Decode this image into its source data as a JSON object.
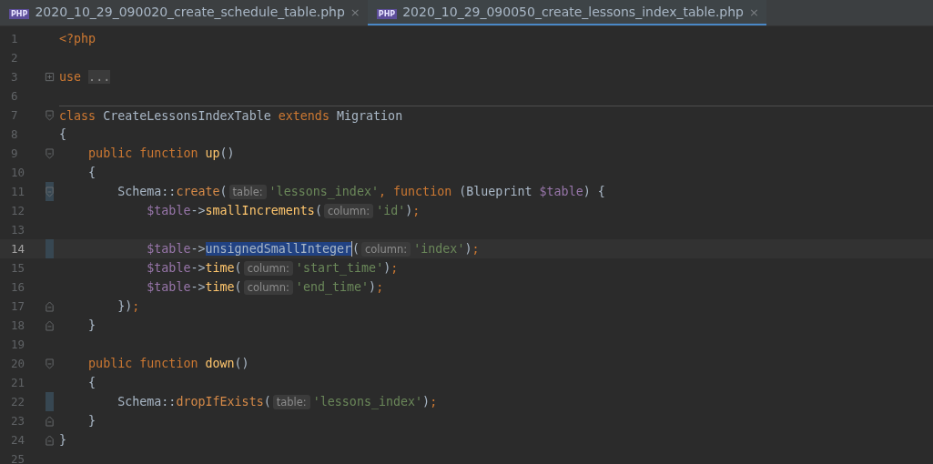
{
  "tabs": [
    {
      "icon_text": "PHP",
      "label": "2020_10_29_090020_create_schedule_table.php",
      "close": "×",
      "selected": false
    },
    {
      "icon_text": "PHP",
      "label": "2020_10_29_090050_create_lessons_index_table.php",
      "close": "×",
      "selected": true
    }
  ],
  "editor": {
    "lines": [
      {
        "number": "1",
        "changed": false,
        "current": false,
        "separator": false,
        "tokens": [
          {
            "kind": "keyword",
            "text": "<?php"
          }
        ]
      },
      {
        "number": "2",
        "changed": false,
        "current": false,
        "separator": false
      },
      {
        "number": "3",
        "fold": {
          "kind": "collapsed"
        },
        "changed": false,
        "current": false,
        "separator": false,
        "tokens": [
          {
            "kind": "keyword",
            "text": "use "
          },
          {
            "kind": "folded",
            "text": "..."
          }
        ]
      },
      {
        "number": "6",
        "changed": false,
        "current": false,
        "separator": false
      },
      {
        "number": "7",
        "fold": {
          "kind": "start"
        },
        "changed": false,
        "current": false,
        "separator": true,
        "tokens": [
          {
            "kind": "keyword",
            "text": "class "
          },
          {
            "kind": "plain",
            "text": "CreateLessonsIndexTable "
          },
          {
            "kind": "keyword",
            "text": "extends "
          },
          {
            "kind": "plain",
            "text": "Migration"
          }
        ]
      },
      {
        "number": "8",
        "changed": false,
        "current": false,
        "separator": false,
        "tokens": [
          {
            "kind": "plain",
            "text": "{"
          }
        ]
      },
      {
        "number": "9",
        "fold": {
          "kind": "start"
        },
        "changed": false,
        "current": false,
        "separator": false,
        "tokens": [
          {
            "kind": "keyword",
            "text": "    public function "
          },
          {
            "kind": "function",
            "text": "up"
          },
          {
            "kind": "plain",
            "text": "()"
          }
        ]
      },
      {
        "number": "10",
        "changed": false,
        "current": false,
        "separator": false,
        "tokens": [
          {
            "kind": "plain",
            "text": "    {"
          }
        ]
      },
      {
        "number": "11",
        "fold": {
          "kind": "start"
        },
        "changed": true,
        "current": false,
        "separator": false,
        "tokens": [
          {
            "kind": "plain",
            "text": "        Schema::"
          },
          {
            "kind": "method",
            "text": "create"
          },
          {
            "kind": "plain",
            "text": "("
          },
          {
            "kind": "hint",
            "text": "table:"
          },
          {
            "kind": "string",
            "text": "'lessons_index'"
          },
          {
            "kind": "keyword",
            "text": ", function "
          },
          {
            "kind": "plain",
            "text": "(Blueprint "
          },
          {
            "kind": "variable",
            "text": "$table"
          },
          {
            "kind": "plain",
            "text": ") {"
          }
        ]
      },
      {
        "number": "12",
        "changed": false,
        "current": false,
        "separator": false,
        "tokens": [
          {
            "kind": "variable",
            "text": "            $table"
          },
          {
            "kind": "plain",
            "text": "->"
          },
          {
            "kind": "function",
            "text": "smallIncrements"
          },
          {
            "kind": "plain",
            "text": "("
          },
          {
            "kind": "hint",
            "text": "column:"
          },
          {
            "kind": "string",
            "text": "'id'"
          },
          {
            "kind": "plain",
            "text": ")"
          },
          {
            "kind": "keyword",
            "text": ";"
          }
        ]
      },
      {
        "number": "13",
        "changed": false,
        "current": false,
        "separator": false
      },
      {
        "number": "14",
        "changed": true,
        "current": true,
        "separator": false,
        "tokens": [
          {
            "kind": "variable",
            "text": "            $table"
          },
          {
            "kind": "plain",
            "text": "->"
          },
          {
            "kind": "selected",
            "text": "unsignedSmallInteger"
          },
          {
            "kind": "plain",
            "text": "("
          },
          {
            "kind": "hint",
            "text": "column:"
          },
          {
            "kind": "string",
            "text": "'index'"
          },
          {
            "kind": "plain",
            "text": ")"
          },
          {
            "kind": "keyword",
            "text": ";"
          }
        ]
      },
      {
        "number": "15",
        "changed": false,
        "current": false,
        "separator": false,
        "tokens": [
          {
            "kind": "variable",
            "text": "            $table"
          },
          {
            "kind": "plain",
            "text": "->"
          },
          {
            "kind": "function",
            "text": "time"
          },
          {
            "kind": "plain",
            "text": "("
          },
          {
            "kind": "hint",
            "text": "column:"
          },
          {
            "kind": "string",
            "text": "'start_time'"
          },
          {
            "kind": "plain",
            "text": ")"
          },
          {
            "kind": "keyword",
            "text": ";"
          }
        ]
      },
      {
        "number": "16",
        "changed": false,
        "current": false,
        "separator": false,
        "tokens": [
          {
            "kind": "variable",
            "text": "            $table"
          },
          {
            "kind": "plain",
            "text": "->"
          },
          {
            "kind": "function",
            "text": "time"
          },
          {
            "kind": "plain",
            "text": "("
          },
          {
            "kind": "hint",
            "text": "column:"
          },
          {
            "kind": "string",
            "text": "'end_time'"
          },
          {
            "kind": "plain",
            "text": ")"
          },
          {
            "kind": "keyword",
            "text": ";"
          }
        ]
      },
      {
        "number": "17",
        "fold": {
          "kind": "end"
        },
        "changed": false,
        "current": false,
        "separator": false,
        "tokens": [
          {
            "kind": "plain",
            "text": "        })"
          },
          {
            "kind": "keyword",
            "text": ";"
          }
        ]
      },
      {
        "number": "18",
        "fold": {
          "kind": "end"
        },
        "changed": false,
        "current": false,
        "separator": false,
        "tokens": [
          {
            "kind": "plain",
            "text": "    }"
          }
        ]
      },
      {
        "number": "19",
        "changed": false,
        "current": false,
        "separator": false
      },
      {
        "number": "20",
        "fold": {
          "kind": "start"
        },
        "changed": false,
        "current": false,
        "separator": false,
        "tokens": [
          {
            "kind": "keyword",
            "text": "    public function "
          },
          {
            "kind": "function",
            "text": "down"
          },
          {
            "kind": "plain",
            "text": "()"
          }
        ]
      },
      {
        "number": "21",
        "changed": false,
        "current": false,
        "separator": false,
        "tokens": [
          {
            "kind": "plain",
            "text": "    {"
          }
        ]
      },
      {
        "number": "22",
        "changed": true,
        "current": false,
        "separator": false,
        "tokens": [
          {
            "kind": "plain",
            "text": "        Schema::"
          },
          {
            "kind": "method",
            "text": "dropIfExists"
          },
          {
            "kind": "plain",
            "text": "("
          },
          {
            "kind": "hint",
            "text": "table:"
          },
          {
            "kind": "string",
            "text": "'lessons_index'"
          },
          {
            "kind": "plain",
            "text": ")"
          },
          {
            "kind": "keyword",
            "text": ";"
          }
        ]
      },
      {
        "number": "23",
        "fold": {
          "kind": "end"
        },
        "changed": false,
        "current": false,
        "separator": false,
        "tokens": [
          {
            "kind": "plain",
            "text": "    }"
          }
        ]
      },
      {
        "number": "24",
        "fold": {
          "kind": "end"
        },
        "changed": false,
        "current": false,
        "separator": false,
        "tokens": [
          {
            "kind": "plain",
            "text": "}"
          }
        ]
      },
      {
        "number": "25",
        "changed": false,
        "current": false,
        "separator": false
      }
    ]
  }
}
